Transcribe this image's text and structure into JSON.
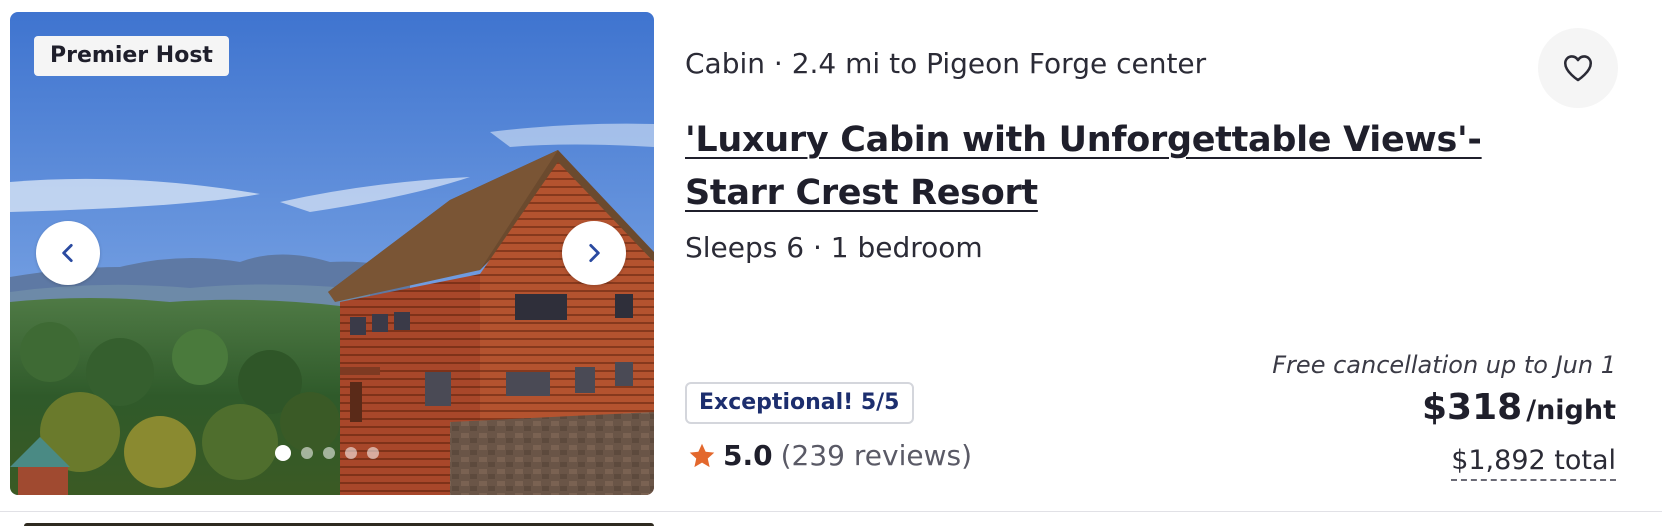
{
  "listing": {
    "host_badge": "Premier Host",
    "meta": "Cabin · 2.4 mi to Pigeon Forge center",
    "title": "'Luxury Cabin with Unforgettable Views'- Starr Crest Resort",
    "sleeps": "Sleeps 6 · 1 bedroom",
    "rating_badge": "Exceptional! 5/5",
    "rating_score": "5.0",
    "review_count": "(239 reviews)",
    "cancellation": "Free cancellation up to Jun 1",
    "price": "$318",
    "price_unit": "/night",
    "total": "$1,892 total"
  },
  "carousel": {
    "slide_count": 5,
    "active_slide": 1,
    "prev_icon": "chevron-left-icon",
    "next_icon": "chevron-right-icon"
  },
  "icons": {
    "favorite": "heart-icon",
    "rating": "star-icon"
  },
  "colors": {
    "rating_text": "#1c2e6e",
    "star": "#e3682d",
    "chevron": "#2a4aa0",
    "text": "#1f1f2b"
  }
}
